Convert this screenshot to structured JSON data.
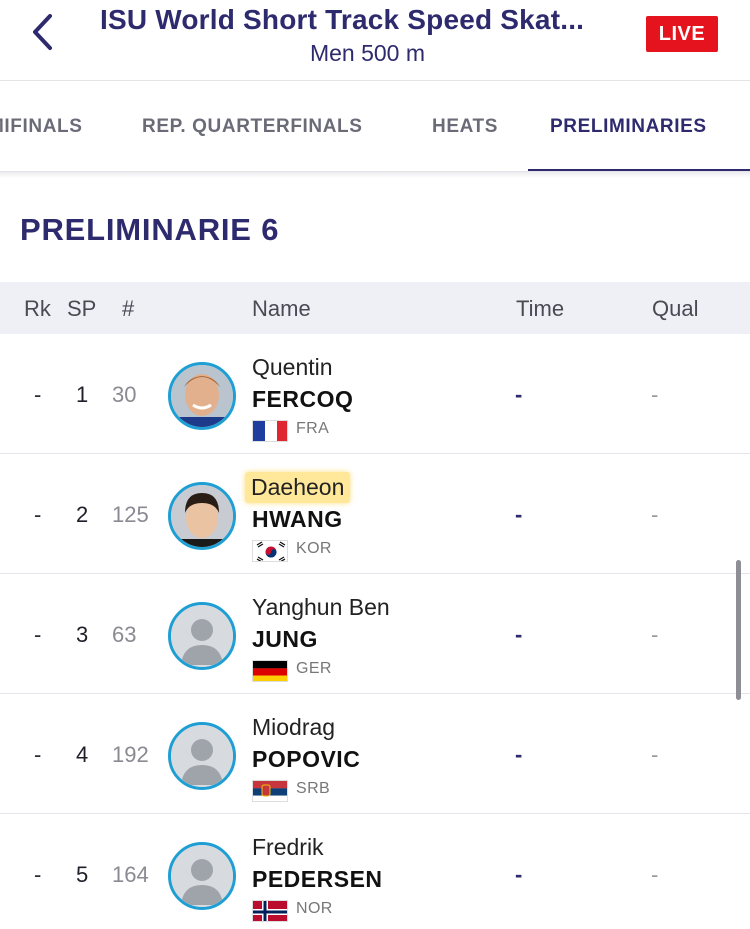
{
  "header": {
    "title": "ISU World Short Track Speed Skat...",
    "subtitle": "Men 500 m",
    "live_label": "LIVE"
  },
  "tabs": [
    {
      "label": "MIFINALS",
      "active": false
    },
    {
      "label": "REP. QUARTERFINALS",
      "active": false
    },
    {
      "label": "HEATS",
      "active": false
    },
    {
      "label": "PRELIMINARIES",
      "active": true
    }
  ],
  "section": {
    "title": "PRELIMINARIE 6"
  },
  "columns": {
    "rk": "Rk",
    "sp": "SP",
    "num": "#",
    "name": "Name",
    "time": "Time",
    "qual": "Qual"
  },
  "athletes": [
    {
      "rk": "-",
      "sp": "1",
      "num": "30",
      "first": "Quentin",
      "last": "FERCOQ",
      "country": "FRA",
      "time": "-",
      "qual": "-",
      "highlight": false
    },
    {
      "rk": "-",
      "sp": "2",
      "num": "125",
      "first": "Daeheon",
      "last": "HWANG",
      "country": "KOR",
      "time": "-",
      "qual": "-",
      "highlight": true
    },
    {
      "rk": "-",
      "sp": "3",
      "num": "63",
      "first": "Yanghun Ben",
      "last": "JUNG",
      "country": "GER",
      "time": "-",
      "qual": "-",
      "highlight": false
    },
    {
      "rk": "-",
      "sp": "4",
      "num": "192",
      "first": "Miodrag",
      "last": "POPOVIC",
      "country": "SRB",
      "time": "-",
      "qual": "-",
      "highlight": false
    },
    {
      "rk": "-",
      "sp": "5",
      "num": "164",
      "first": "Fredrik",
      "last": "PEDERSEN",
      "country": "NOR",
      "time": "-",
      "qual": "-",
      "highlight": false
    }
  ],
  "colors": {
    "brand": "#2e2a6e",
    "live": "#e4131d",
    "avatar_ring": "#1e9fd4",
    "highlight": "#ffe89a"
  }
}
